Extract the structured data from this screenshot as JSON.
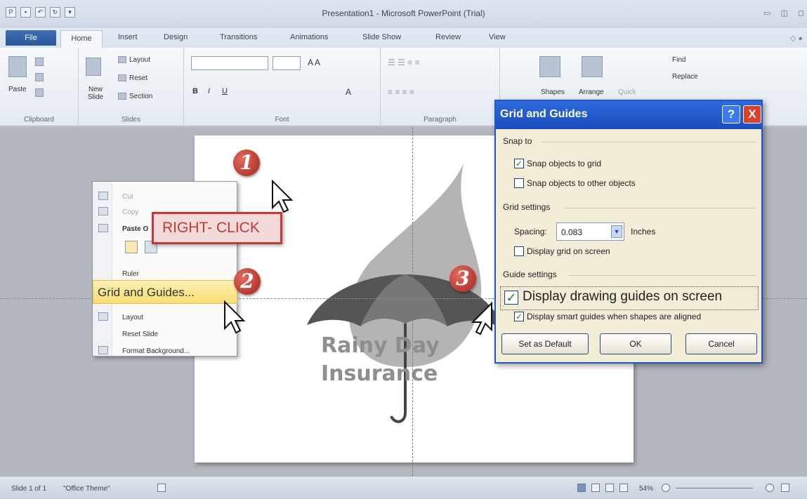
{
  "app": {
    "title": "Presentation1 - Microsoft PowerPoint (Trial)"
  },
  "tabs": [
    "File",
    "Home",
    "Insert",
    "Design",
    "Transitions",
    "Animations",
    "Slide Show",
    "Review",
    "View"
  ],
  "ribbon": {
    "clipboard": {
      "paste": "Paste",
      "label": "Clipboard"
    },
    "slides": {
      "new_slide": "New Slide",
      "layout": "Layout",
      "reset": "Reset",
      "section": "Section",
      "label": "Slides"
    },
    "font": {
      "label": "Font"
    },
    "paragraph": {
      "label": "Paragraph"
    },
    "drawing": {
      "shapes": "Shapes",
      "arrange": "Arrange",
      "quick": "Quick"
    },
    "editing": {
      "find": "Find",
      "replace": "Replace"
    }
  },
  "slide": {
    "brand_line1": "Rainy Day",
    "brand_line2": "Insurance"
  },
  "context_menu": {
    "cut": "Cut",
    "copy": "Copy",
    "paste_options": "Paste O",
    "ruler": "Ruler",
    "grid_and_guides": "Grid and Guides...",
    "layout": "Layout",
    "reset_slide": "Reset Slide",
    "format_background": "Format Background..."
  },
  "callout_label": "RIGHT- CLICK",
  "steps": [
    "1",
    "2",
    "3"
  ],
  "dialog": {
    "title": "Grid and Guides",
    "help": "?",
    "close": "X",
    "snap_to": "Snap to",
    "snap_grid": "Snap objects to grid",
    "snap_grid_checked": true,
    "snap_other": "Snap objects to other objects",
    "snap_other_checked": false,
    "grid_settings": "Grid settings",
    "spacing_label": "Spacing:",
    "spacing_value": "0.083",
    "spacing_unit": "Inches",
    "display_grid": "Display grid on screen",
    "display_grid_checked": false,
    "guide_settings": "Guide settings",
    "display_guides": "Display drawing guides on screen",
    "display_guides_checked": true,
    "smart_guides": "Display smart guides when shapes are aligned",
    "smart_guides_checked": true,
    "set_default": "Set as Default",
    "ok": "OK",
    "cancel": "Cancel"
  },
  "status": {
    "slide_info": "Slide 1 of 1",
    "theme": "\"Office Theme\"",
    "zoom": "54%"
  },
  "colors": {
    "accent_blue": "#1f56c4",
    "callout_red": "#c0393b",
    "highlight_yellow": "#f9dd72"
  }
}
